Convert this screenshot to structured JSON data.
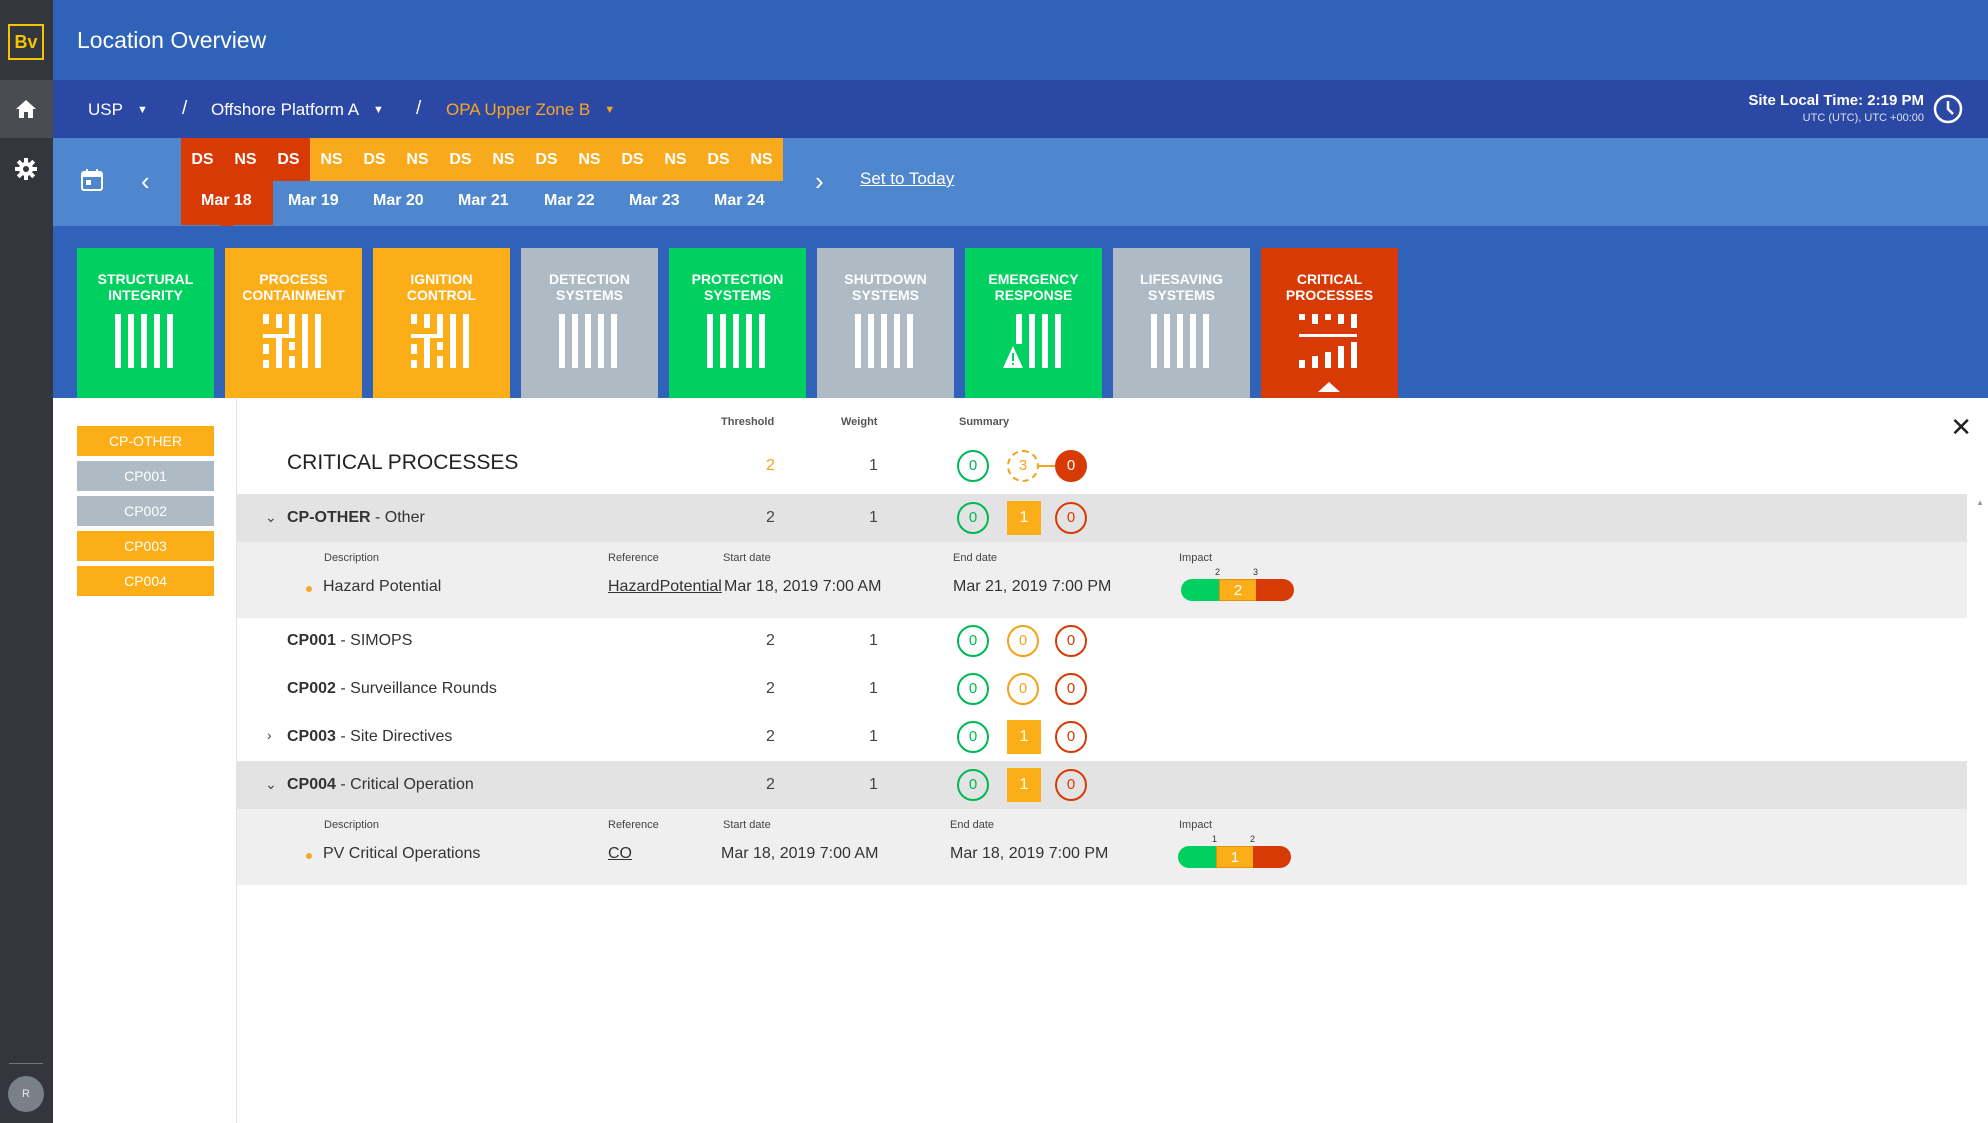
{
  "app": {
    "logo": "Bv",
    "title": "Location Overview",
    "user_initial": "R"
  },
  "breadcrumb": [
    {
      "label": "USP"
    },
    {
      "label": "Offshore Platform A"
    },
    {
      "label": "OPA Upper Zone B"
    }
  ],
  "site_time": {
    "label": "Site Local Time: 2:19 PM",
    "tz": "UTC (UTC), UTC +00:00"
  },
  "datebar": {
    "shifts": [
      "DS",
      "NS",
      "DS",
      "NS",
      "DS",
      "NS",
      "DS",
      "NS",
      "DS",
      "NS",
      "DS",
      "NS",
      "DS",
      "NS"
    ],
    "days": [
      "Mar 18",
      "Mar 19",
      "Mar 20",
      "Mar 21",
      "Mar 22",
      "Mar 23",
      "Mar 24"
    ],
    "set_today": "Set to Today"
  },
  "tiles": [
    {
      "line1": "STRUCTURAL",
      "line2": "INTEGRITY",
      "color": "#00d060"
    },
    {
      "line1": "PROCESS",
      "line2": "CONTAINMENT",
      "color": "#fbae17"
    },
    {
      "line1": "IGNITION",
      "line2": "CONTROL",
      "color": "#fbae17"
    },
    {
      "line1": "DETECTION",
      "line2": "SYSTEMS",
      "color": "#aebbc4"
    },
    {
      "line1": "PROTECTION",
      "line2": "SYSTEMS",
      "color": "#00d060"
    },
    {
      "line1": "SHUTDOWN",
      "line2": "SYSTEMS",
      "color": "#aebbc4"
    },
    {
      "line1": "EMERGENCY",
      "line2": "RESPONSE",
      "color": "#00d060"
    },
    {
      "line1": "LIFESAVING",
      "line2": "SYSTEMS",
      "color": "#aebbc4"
    },
    {
      "line1": "CRITICAL",
      "line2": "PROCESSES",
      "color": "#d83a05"
    }
  ],
  "chips": [
    "CP-OTHER",
    "CP001",
    "CP002",
    "CP003",
    "CP004"
  ],
  "table": {
    "headers": {
      "threshold": "Threshold",
      "weight": "Weight",
      "summary": "Summary"
    },
    "title": "CRITICAL PROCESSES",
    "title_threshold": "2",
    "title_weight": "1",
    "title_summary": [
      "0",
      "3",
      "0"
    ],
    "detail_headers": {
      "description": "Description",
      "reference": "Reference",
      "start": "Start date",
      "end": "End date",
      "impact": "Impact"
    },
    "rows": [
      {
        "code": "CP-OTHER",
        "name": " - Other",
        "threshold": "2",
        "weight": "1",
        "summary": [
          "0",
          "1",
          "0"
        ]
      },
      {
        "code": "CP001",
        "name": " - SIMOPS",
        "threshold": "2",
        "weight": "1",
        "summary": [
          "0",
          "0",
          "0"
        ]
      },
      {
        "code": "CP002",
        "name": " - Surveillance Rounds",
        "threshold": "2",
        "weight": "1",
        "summary": [
          "0",
          "0",
          "0"
        ]
      },
      {
        "code": "CP003",
        "name": " - Site Directives",
        "threshold": "2",
        "weight": "1",
        "summary": [
          "0",
          "1",
          "0"
        ]
      },
      {
        "code": "CP004",
        "name": " - Critical Operation",
        "threshold": "2",
        "weight": "1",
        "summary": [
          "0",
          "1",
          "0"
        ]
      }
    ],
    "details": [
      {
        "description": "Hazard Potential",
        "reference": "HazardPotential",
        "start": "Mar 18, 2019 7:00 AM",
        "end": "Mar 21, 2019 7:00 PM",
        "impact_value": "2",
        "impact_low": "2",
        "impact_high": "3"
      },
      {
        "description": "PV Critical Operations",
        "reference": "CO",
        "start": "Mar 18, 2019 7:00 AM",
        "end": "Mar 18, 2019 7:00 PM",
        "impact_value": "1",
        "impact_low": "1",
        "impact_high": "2"
      }
    ]
  }
}
